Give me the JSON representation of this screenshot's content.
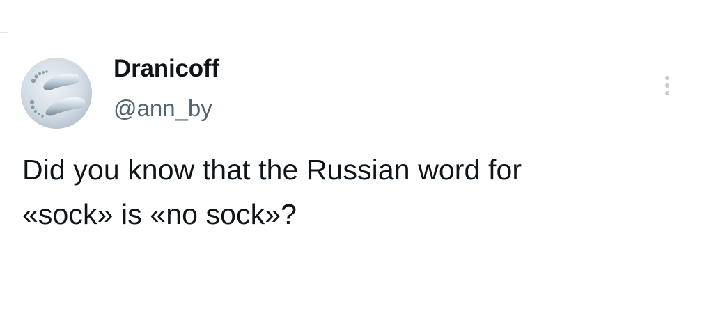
{
  "author": {
    "display_name": "Dranicoff",
    "handle": "@ann_by",
    "avatar_icon": "footprints-avatar-icon"
  },
  "tweet": {
    "text_lines": [
      "Did you know that the Russian word for",
      "«sock» is «no sock»?"
    ]
  },
  "actions": {
    "more_icon": "vertical-ellipsis-icon"
  },
  "colors": {
    "text_primary": "#0f1419",
    "text_secondary": "#536471",
    "icon_muted": "#c5ccd3",
    "background": "#ffffff"
  }
}
